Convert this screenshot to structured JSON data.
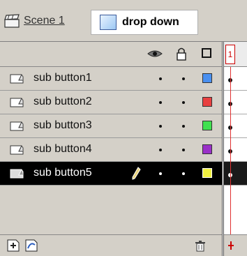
{
  "breadcrumb": {
    "scene_label": "Scene 1",
    "symbol_label": "drop down"
  },
  "header": {
    "icons": [
      "eye-icon",
      "lock-icon",
      "outline-icon"
    ]
  },
  "timeline": {
    "current_frame": "1"
  },
  "layers": [
    {
      "name": "sub button1",
      "color": "#4a90f0",
      "selected": false
    },
    {
      "name": "sub button2",
      "color": "#e84040",
      "selected": false
    },
    {
      "name": "sub button3",
      "color": "#40e050",
      "selected": false
    },
    {
      "name": "sub button4",
      "color": "#9a30c8",
      "selected": false
    },
    {
      "name": "sub button5",
      "color": "#f0f040",
      "selected": true
    }
  ],
  "toolbar": {
    "icons": [
      "insert-layer-icon",
      "add-motion-guide-icon",
      "delete-layer-icon"
    ]
  }
}
